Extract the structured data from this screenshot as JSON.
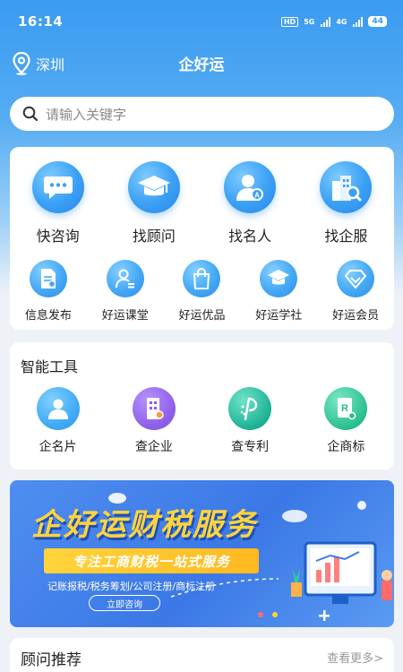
{
  "status_bar": {
    "time": "16:14",
    "hd": "HD",
    "net1": "5G",
    "net2": "4G",
    "battery": "44"
  },
  "header": {
    "location": "深圳",
    "title": "企好运"
  },
  "search": {
    "placeholder": "请输入关键字"
  },
  "services": {
    "primary": [
      {
        "label": "快咨询",
        "icon": "chat-bubble-icon"
      },
      {
        "label": "找顾问",
        "icon": "graduation-cap-icon"
      },
      {
        "label": "找名人",
        "icon": "person-badge-icon"
      },
      {
        "label": "找企服",
        "icon": "building-search-icon"
      }
    ],
    "secondary": [
      {
        "label": "信息发布",
        "icon": "document-icon"
      },
      {
        "label": "好运课堂",
        "icon": "user-list-icon"
      },
      {
        "label": "好运优品",
        "icon": "shopping-bag-icon"
      },
      {
        "label": "好运学社",
        "icon": "graduation-cap-icon"
      },
      {
        "label": "好运会员",
        "icon": "diamond-icon"
      }
    ]
  },
  "tools": {
    "title": "智能工具",
    "items": [
      {
        "label": "企名片",
        "icon": "person-card-icon",
        "color": "#3aa6f2"
      },
      {
        "label": "查企业",
        "icon": "building-icon",
        "color": "#8b5ce6"
      },
      {
        "label": "查专利",
        "icon": "patent-icon",
        "color": "#23c0a5"
      },
      {
        "label": "企商标",
        "icon": "trademark-icon",
        "color": "#2ec69a"
      }
    ]
  },
  "banner": {
    "title": "企好运财税服务",
    "strip": "专注工商财税一站式服务",
    "subtitle": "记账报税/税务筹划/公司注册/商标注册",
    "button": "立即咨询"
  },
  "recommend": {
    "title": "顾问推荐",
    "more": "查看更多>"
  },
  "colors": {
    "primary": "#3a9bf0",
    "banner_yellow": "#ffd43b"
  }
}
